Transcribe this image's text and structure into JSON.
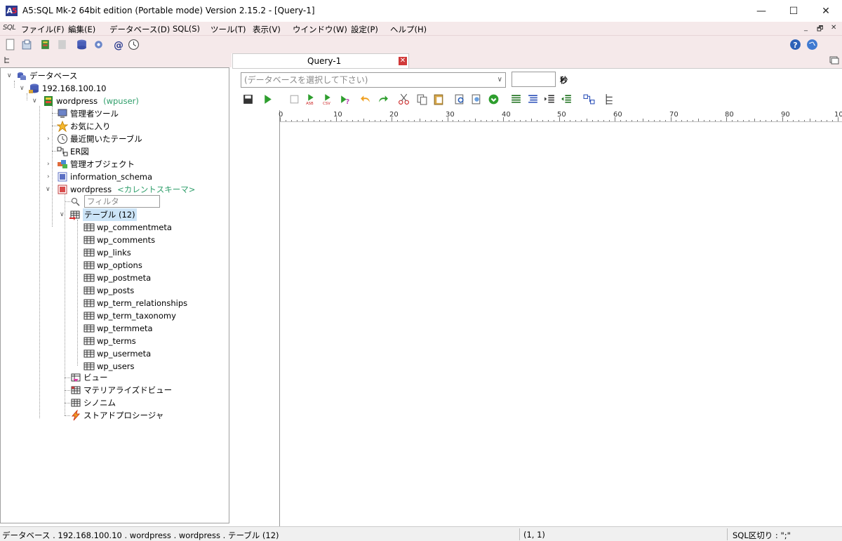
{
  "window": {
    "title": "A5:SQL Mk-2 64bit edition (Portable mode) Version 2.15.2 - [Query-1]",
    "minimize": "—",
    "maximize": "☐",
    "close": "✕"
  },
  "menu": {
    "logo": "SQL",
    "items": [
      "ファイル(F)",
      "編集(E)",
      "データベース(D)",
      "SQL(S)",
      "ツール(T)",
      "表示(V)",
      "ウインドウ(W)",
      "設定(P)",
      "ヘルプ(H)"
    ],
    "mdi_min": "_",
    "mdi_restore": "🗗",
    "mdi_close": "✕"
  },
  "tree": {
    "root": "データベース",
    "host": "192.168.100.10",
    "db": "wordpress",
    "db_user": "(wpuser)",
    "admin_tools": "管理者ツール",
    "favorites": "お気に入り",
    "recent_tables": "最近開いたテーブル",
    "er": "ER図",
    "admin_objects": "管理オブジェクト",
    "info_schema": "information_schema",
    "schema": "wordpress",
    "schema_note": "<カレントスキーマ>",
    "filter_placeholder": "フィルタ",
    "tables_label": "テーブル (12)",
    "tables": [
      "wp_commentmeta",
      "wp_comments",
      "wp_links",
      "wp_options",
      "wp_postmeta",
      "wp_posts",
      "wp_term_relationships",
      "wp_term_taxonomy",
      "wp_termmeta",
      "wp_terms",
      "wp_usermeta",
      "wp_users"
    ],
    "views": "ビュー",
    "mviews": "マテリアライズドビュー",
    "synonyms": "シノニム",
    "procs": "ストアドプロシージャ"
  },
  "query": {
    "tab_label": "Query-1",
    "db_select_placeholder": "(データベースを選択して下さい)",
    "seconds_label": "秒",
    "ruler": [
      "0",
      "10",
      "20",
      "30",
      "40",
      "50",
      "60",
      "70",
      "80",
      "90",
      "10"
    ]
  },
  "status": {
    "path": "データベース . 192.168.100.10 . wordpress . wordpress . テーブル (12)",
    "position": "(1, 1)",
    "delimiter": "SQL区切り : \";\""
  }
}
